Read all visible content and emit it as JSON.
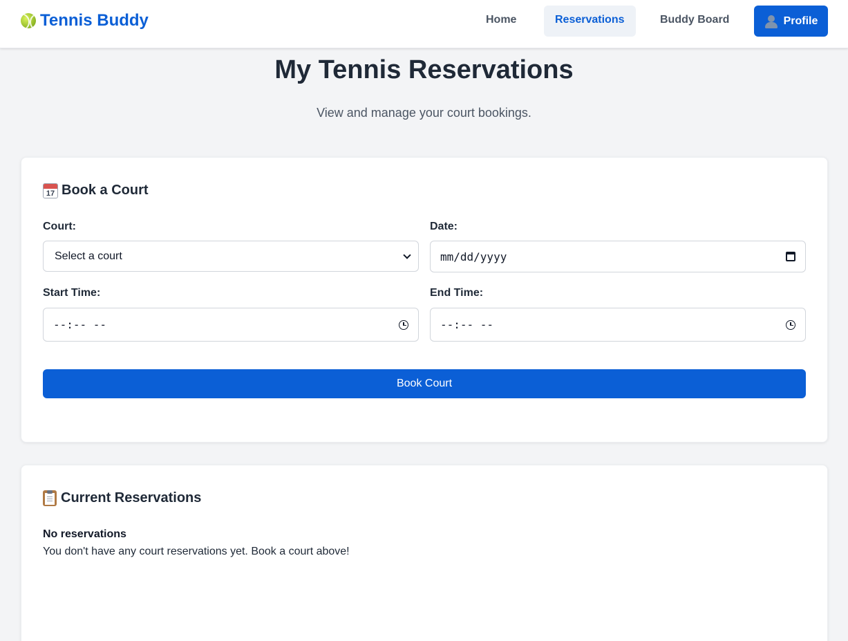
{
  "header": {
    "brand": "Tennis Buddy",
    "nav": {
      "home": "Home",
      "reservations": "Reservations",
      "buddy_board": "Buddy Board"
    },
    "profile_label": "Profile"
  },
  "page": {
    "title": "My Tennis Reservations",
    "subtitle": "View and manage your court bookings."
  },
  "book_court": {
    "title": "Book a Court",
    "icon_number": "17",
    "court_label": "Court:",
    "court_selected": "Select a court",
    "date_label": "Date:",
    "date_placeholder": "mm/dd/yyyy",
    "start_label": "Start Time:",
    "start_placeholder": "--:-- --",
    "end_label": "End Time:",
    "end_placeholder": "--:-- --",
    "submit_label": "Book Court"
  },
  "current_reservations": {
    "title": "Current Reservations",
    "empty_title": "No reservations",
    "empty_text": "You don't have any court reservations yet. Book a court above!"
  },
  "colors": {
    "primary": "#0b5fd6",
    "background": "#f3f4f6",
    "active_nav_bg": "#eef2f7"
  },
  "icons": {
    "brand": "tennis-ball-icon",
    "profile": "person-icon",
    "book_court": "calendar-icon",
    "current_reservations": "clipboard-icon",
    "court_select": "chevron-down-icon",
    "date": "calendar-picker-icon",
    "time": "clock-icon"
  }
}
